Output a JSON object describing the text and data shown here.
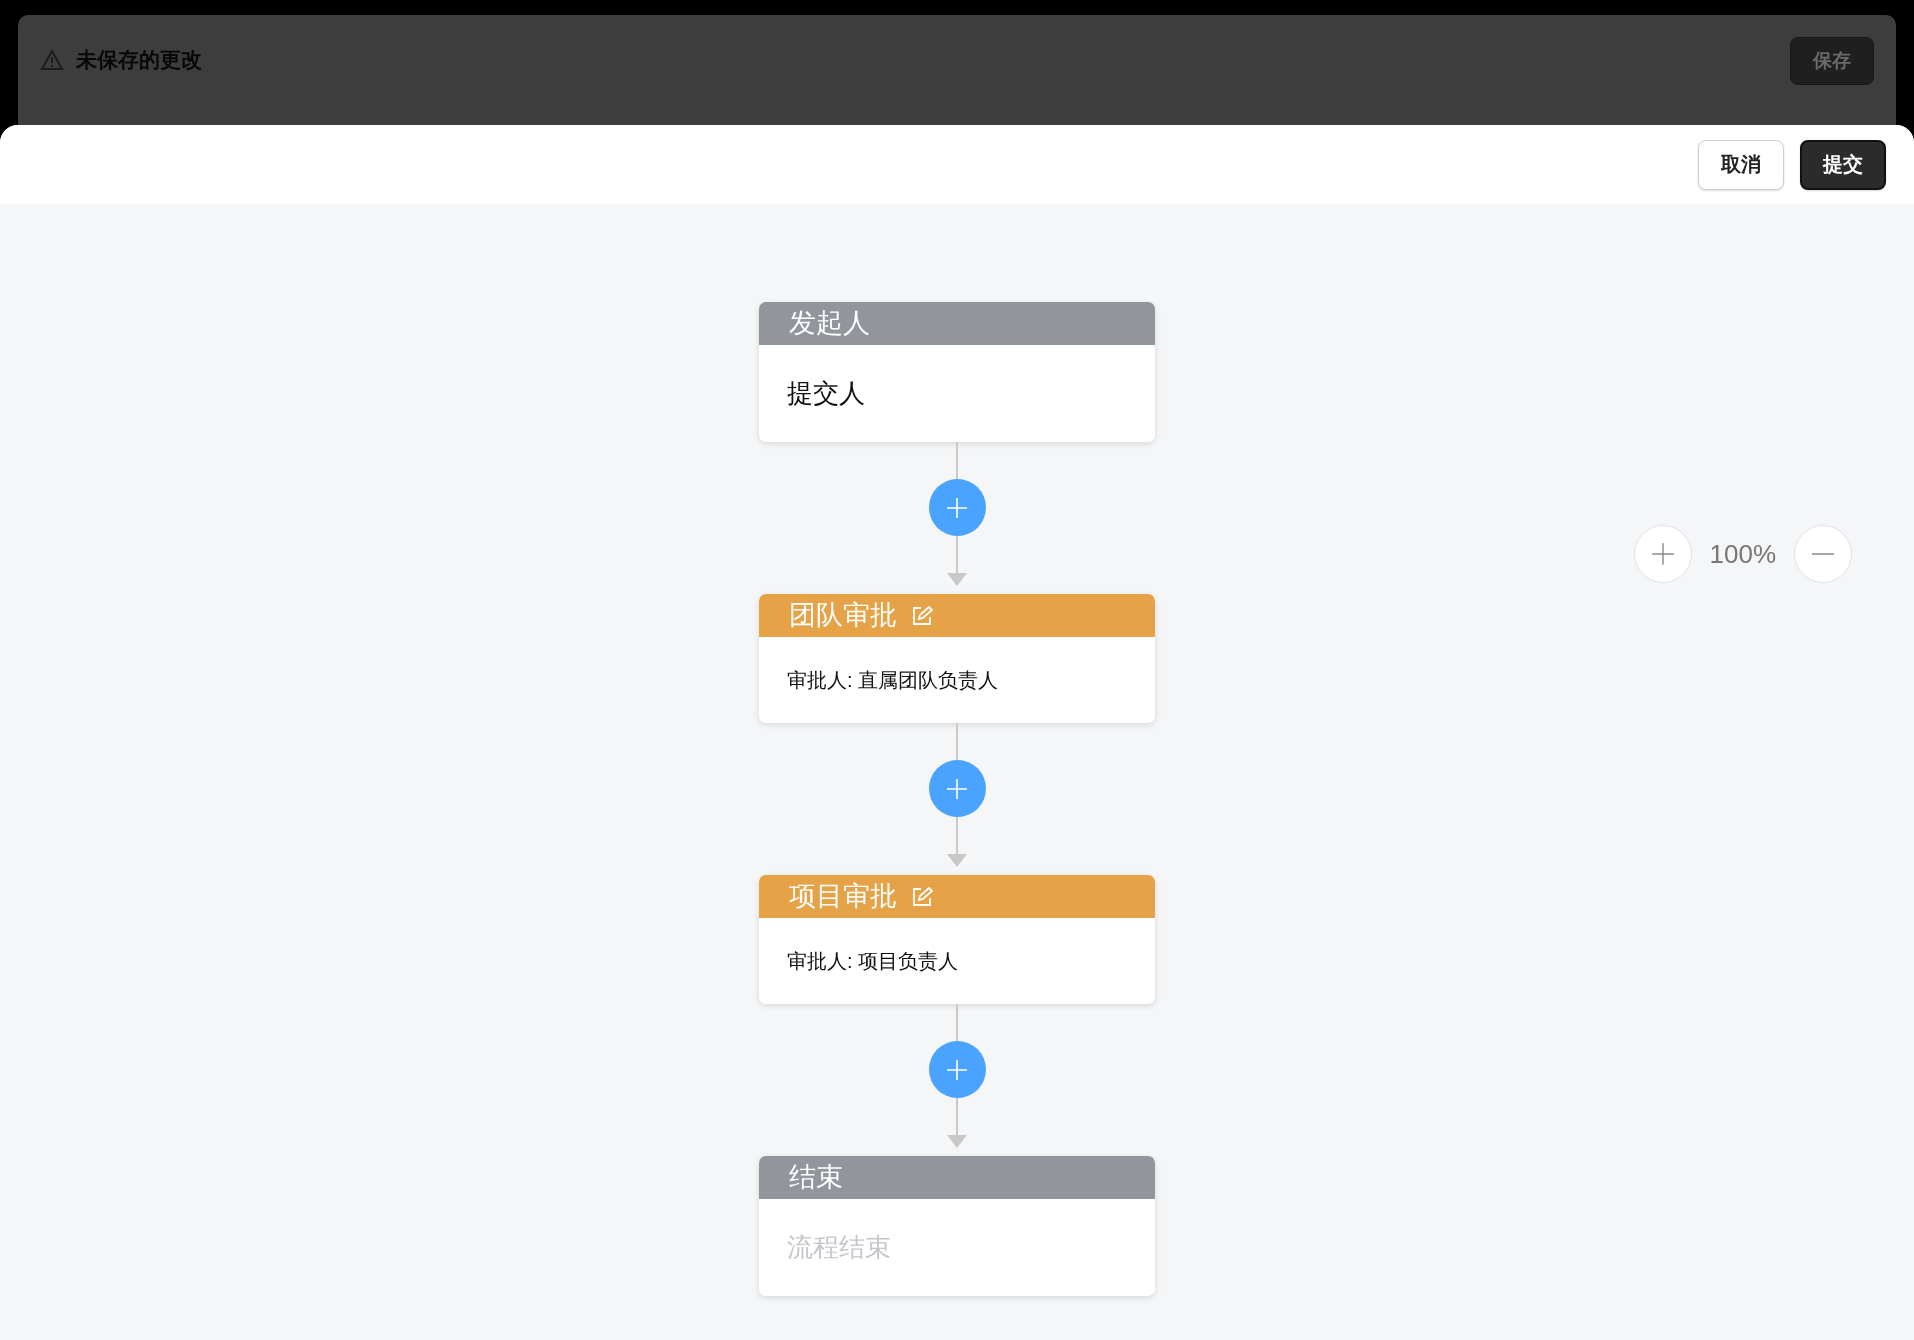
{
  "background_bar": {
    "notice": "未保存的更改",
    "save_button": "保存"
  },
  "sheet": {
    "buttons": [
      {
        "label": "取消",
        "kind": "secondary"
      },
      {
        "label": "提交",
        "kind": "primary"
      }
    ]
  },
  "flow": {
    "nodes": [
      {
        "kind": "start",
        "title": "发起人",
        "body": "提交人"
      },
      {
        "kind": "approval",
        "title": "团队审批",
        "body": "审批人: 直属团队负责人"
      },
      {
        "kind": "approval",
        "title": "项目审批",
        "body": "审批人: 项目负责人"
      },
      {
        "kind": "end",
        "title": "结束",
        "body": "流程结束"
      }
    ]
  },
  "zoom": {
    "value": "100%"
  }
}
